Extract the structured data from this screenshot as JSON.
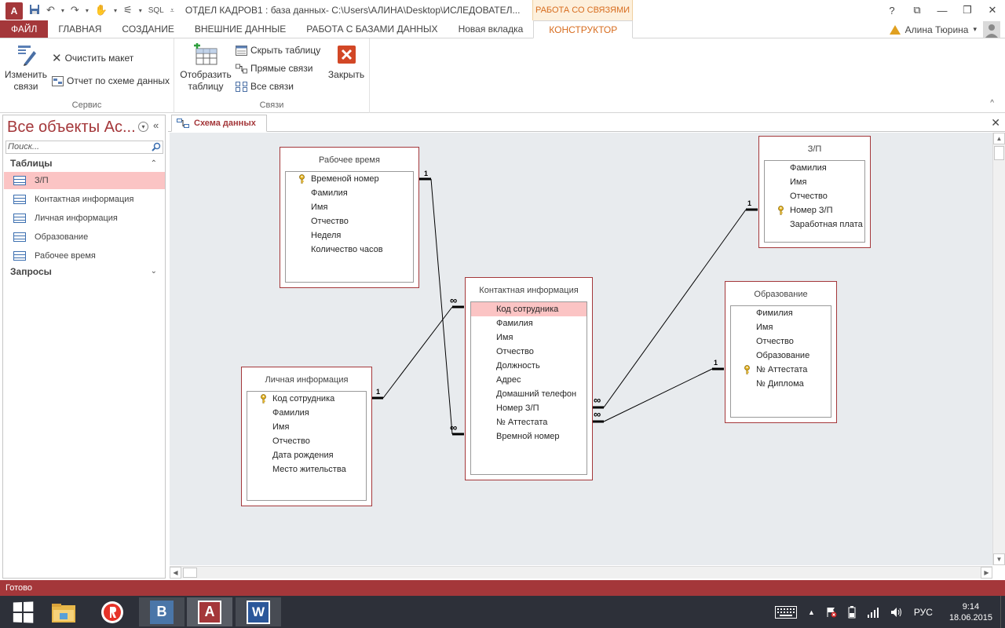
{
  "window": {
    "title": "ОТДЕЛ КАДРОВ1 : база данных- C:\\Users\\АЛИНА\\Desktop\\ИСЛЕДОВАТЕЛ...",
    "context_tab_group": "РАБОТА СО СВЯЗЯМИ",
    "app_icon_text": "A",
    "qat_sql": "SQL",
    "help": "?",
    "restore_ribbon": "⧉",
    "minimize": "—",
    "maximize": "❐",
    "close": "✕"
  },
  "ribbon_tabs": {
    "file": "ФАЙЛ",
    "home": "ГЛАВНАЯ",
    "create": "СОЗДАНИЕ",
    "external": "ВНЕШНИЕ ДАННЫЕ",
    "dbtools": "РАБОТА С БАЗАМИ ДАННЫХ",
    "newtab": "Новая вкладка",
    "constructor": "КОНСТРУКТОР"
  },
  "user": {
    "name": "Алина Тюрина",
    "dropdown": "▾"
  },
  "ribbon": {
    "group_service": {
      "label": "Сервис",
      "edit_relations": "Изменить\nсвязи",
      "clear_layout": "Очистить макет",
      "report": "Отчет по схеме данных"
    },
    "group_relations": {
      "label": "Связи",
      "show_table": "Отобразить\nтаблицу",
      "hide_table": "Скрыть таблицу",
      "direct_relations": "Прямые связи",
      "all_relations": "Все связи",
      "close": "Закрыть"
    },
    "collapse": "^"
  },
  "nav": {
    "title": "Все объекты Ac...",
    "search_placeholder": "Поиск...",
    "section_tables": "Таблицы",
    "section_queries": "Запросы",
    "tables": [
      {
        "label": "З/П",
        "selected": true
      },
      {
        "label": "Контактная информация",
        "selected": false
      },
      {
        "label": "Личная информация",
        "selected": false
      },
      {
        "label": "Образование",
        "selected": false
      },
      {
        "label": "Рабочее время",
        "selected": false
      }
    ]
  },
  "document": {
    "tab_label": "Схема данных",
    "close": "✕"
  },
  "schema": {
    "tables": {
      "work_time": {
        "title": "Рабочее время",
        "fields": [
          {
            "name": "Временой номер",
            "key": true
          },
          {
            "name": "Фамилия",
            "key": false
          },
          {
            "name": "Имя",
            "key": false
          },
          {
            "name": "Отчество",
            "key": false
          },
          {
            "name": "Неделя",
            "key": false
          },
          {
            "name": "Количество часов",
            "key": false
          }
        ]
      },
      "salary": {
        "title": "З/П",
        "fields": [
          {
            "name": "Фамилия",
            "key": false
          },
          {
            "name": "Имя",
            "key": false
          },
          {
            "name": "Отчество",
            "key": false
          },
          {
            "name": "Номер З/П",
            "key": true
          },
          {
            "name": "Заработная плата",
            "key": false
          }
        ]
      },
      "contact": {
        "title": "Контактная информация",
        "fields": [
          {
            "name": "Код сотрудника",
            "key": false,
            "highlight": true
          },
          {
            "name": "Фамилия",
            "key": false
          },
          {
            "name": "Имя",
            "key": false
          },
          {
            "name": "Отчество",
            "key": false
          },
          {
            "name": "Должность",
            "key": false
          },
          {
            "name": "Адрес",
            "key": false
          },
          {
            "name": "Домашний телефон",
            "key": false
          },
          {
            "name": "Номер З/П",
            "key": false
          },
          {
            "name": "№ Аттестата",
            "key": false
          },
          {
            "name": "Времной номер",
            "key": false
          }
        ]
      },
      "education": {
        "title": "Образование",
        "fields": [
          {
            "name": "Фимилия",
            "key": false
          },
          {
            "name": "Имя",
            "key": false
          },
          {
            "name": "Отчество",
            "key": false
          },
          {
            "name": "Образование",
            "key": false
          },
          {
            "name": "№ Аттестата",
            "key": true
          },
          {
            "name": "№ Диплома",
            "key": false
          }
        ]
      },
      "personal": {
        "title": "Личная информация",
        "fields": [
          {
            "name": "Код сотрудника",
            "key": true
          },
          {
            "name": "Фамилия",
            "key": false
          },
          {
            "name": "Имя",
            "key": false
          },
          {
            "name": "Отчество",
            "key": false
          },
          {
            "name": "Дата рождения",
            "key": false
          },
          {
            "name": "Место жительства",
            "key": false
          }
        ]
      }
    },
    "relation_labels": {
      "one": "1",
      "many": "∞"
    }
  },
  "status": {
    "text": "Готово"
  },
  "taskbar": {
    "apps": [
      "start-icon",
      "file-explorer-icon",
      "yandex-browser-icon",
      "vk-icon",
      "access-icon",
      "word-icon"
    ],
    "vk_letter": "B",
    "access_letter": "A",
    "word_letter": "W",
    "language": "РУС",
    "time": "9:14",
    "date": "18.06.2015"
  },
  "colors": {
    "accent": "#a4373a",
    "context": "#d76c1e",
    "highlight": "#fbc4c4",
    "canvas": "#e8ebee"
  }
}
